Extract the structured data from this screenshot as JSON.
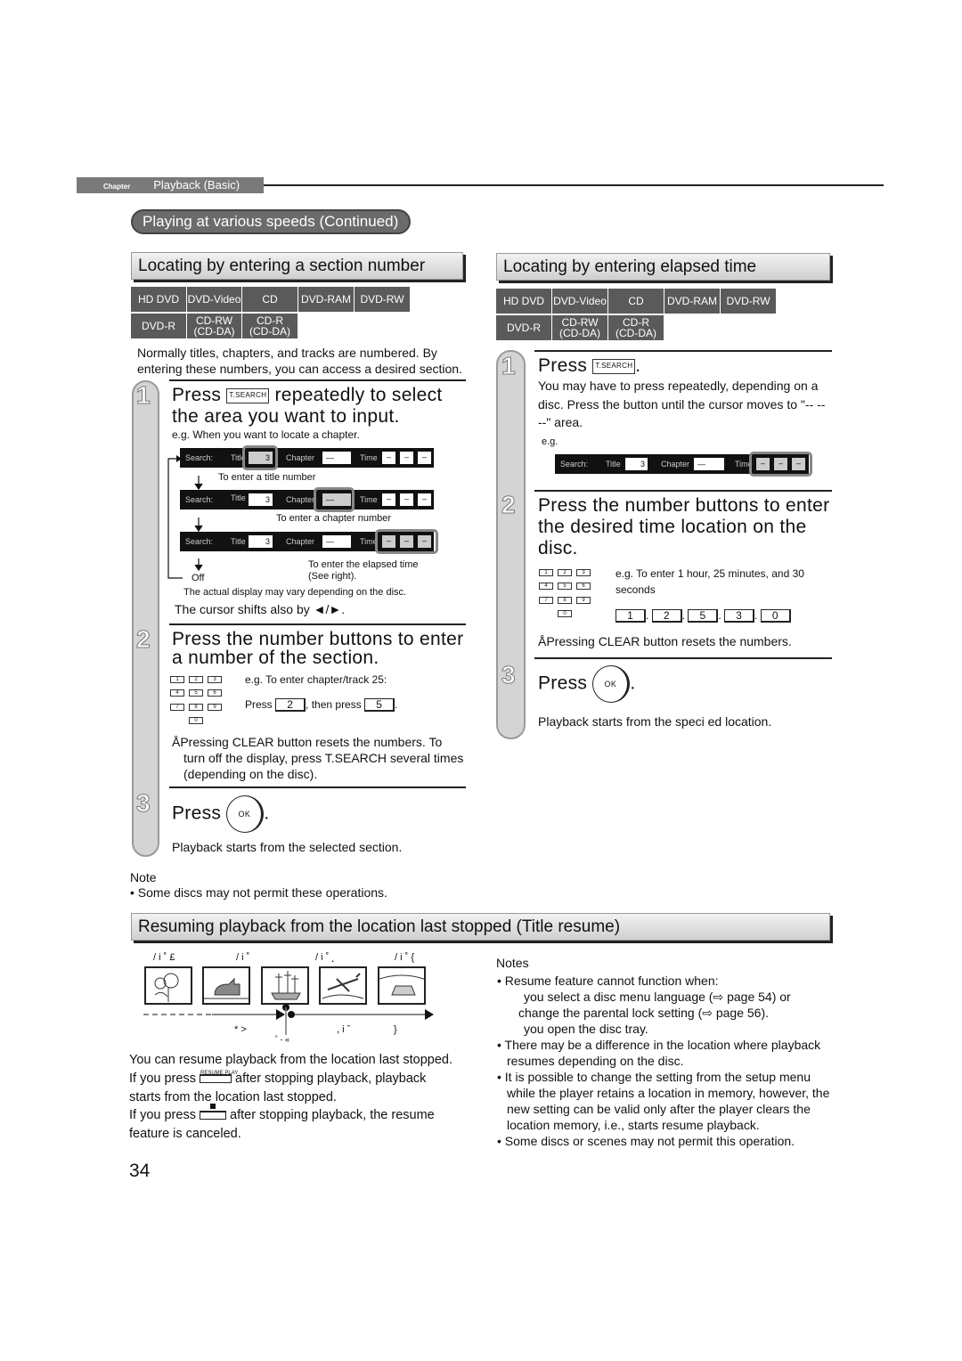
{
  "header": {
    "chapter_label": "Chapter",
    "chapter_title": "Playback (Basic)",
    "section_pill": "Playing at various speeds (Continued)"
  },
  "left": {
    "title": "Locating by entering a section number",
    "badges_row1": [
      "HD DVD",
      "DVD-Video",
      "CD",
      "DVD-RAM",
      "DVD-RW"
    ],
    "badges_row2": [
      "DVD-R",
      "CD-RW\n(CD-DA)",
      "CD-R\n(CD-DA)"
    ],
    "intro": "Normally titles, chapters, and tracks are numbered. By entering these numbers, you can access a desired section.",
    "step1": {
      "num": "1",
      "press": "Press",
      "button": "T.SEARCH",
      "rest": "repeatedly to select the area you want to input.",
      "eg": "e.g. When you want to locate a chapter.",
      "captions": [
        "To enter a title number",
        "To enter a chapter number",
        "To enter the elapsed time\n(See right)."
      ],
      "off": "Off",
      "note": "The actual display may vary depending on the disc.",
      "cursor": "The cursor shifts also by ◄/►."
    },
    "step2": {
      "num": "2",
      "heading": "Press the number buttons to enter a number of the section.",
      "eg": "e.g. To enter chapter/track 25:",
      "press": "Press",
      "key1": "2",
      "then": ", then press",
      "key2": "5",
      "period": ".",
      "note": "ÅPressing CLEAR button resets the numbers. To turn off the display, press T.SEARCH several times (depending on the disc)."
    },
    "step3": {
      "num": "3",
      "press": "Press",
      "ok": "OK",
      "desc": "Playback starts from the selected section."
    },
    "note_title": "Note",
    "note": "• Some discs may not permit these operations."
  },
  "search_display": {
    "search": "Search:",
    "title": "Title",
    "title_value": "3",
    "chapter": "Chapter",
    "chapter_value": "—",
    "time": "Time",
    "time_value": "–"
  },
  "keypad": [
    "1",
    "2",
    "3",
    "4",
    "5",
    "6",
    "7",
    "8",
    "9",
    "0"
  ],
  "right": {
    "title": "Locating by entering elapsed time",
    "step1": {
      "num": "1",
      "press": "Press",
      "button": "T.SEARCH",
      "desc": "You may have to press repeatedly, depending on a disc. Press the button until the cursor moves to \"-- -- --\" area.",
      "eg": "e.g."
    },
    "step2": {
      "num": "2",
      "heading": "Press the number buttons to enter the desired time location on the disc.",
      "eg": "e.g. To enter 1 hour, 25 minutes, and 30 seconds",
      "keys": [
        "1",
        "2",
        "5",
        "3",
        "0"
      ],
      "note": "ÅPressing CLEAR button resets the numbers."
    },
    "step3": {
      "num": "3",
      "press": "Press",
      "ok": "OK",
      "desc": "Playback starts from the speci   ed location."
    }
  },
  "resume": {
    "title": "Resuming playback from the location last stopped (Title resume)",
    "labels_top": [
      "/      i ˚ £",
      "/      i ˚",
      "/      i ˚ ˛",
      "/      i ˚ {"
    ],
    "labels_bottom": [
      "*   >",
      "˚  -        «",
      ", i ˆ",
      "}"
    ],
    "p1": "You can resume playback from the location last stopped.",
    "p2a": "If you press",
    "p2btn": "RESUME PLAY",
    "p2b": "after stopping playback, playback starts from the location last stopped.",
    "p3a": "If you press",
    "p3b": "after stopping playback, the resume feature is canceled.",
    "notes_title": "Notes",
    "notes": [
      "• Resume feature cannot function when:",
      "you select a disc menu language (⇨ page 54) or",
      "change the parental lock setting (⇨ page 56).",
      "you open the disc tray.",
      "• There may be a difference in the location where playback resumes depending on the disc.",
      "• It is possible to change the setting from the setup menu while the player retains a location in memory, however, the new setting can be valid only after the player clears the location memory, i.e., starts resume playback.",
      "• Some discs or scenes may not permit this operation."
    ]
  },
  "page_number": "34"
}
